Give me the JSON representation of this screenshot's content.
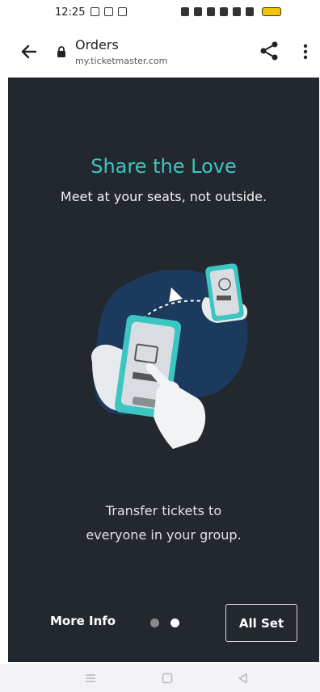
{
  "status_bar": {
    "time": "12:25"
  },
  "header": {
    "title": "Orders",
    "url": "my.ticketmaster.com"
  },
  "slide": {
    "headline": "Share the Love",
    "subhead": "Meet at your seats, not outside.",
    "body_lines": [
      "Transfer tickets to",
      "everyone in your group."
    ],
    "illustration_icon": "phone-transfer-illustration"
  },
  "footer": {
    "more_info_label": "More Info",
    "all_set_label": "All Set",
    "pagination": {
      "total": 2,
      "current": 2
    }
  },
  "colors": {
    "panel_bg": "#23272e",
    "accent": "#3cc6c1",
    "dot_active": "#ffffff",
    "dot_inactive": "#8a8a8a"
  },
  "icons": [
    "back-arrow-icon",
    "lock-icon",
    "share-icon",
    "more-vert-icon",
    "recent-apps-icon",
    "home-icon",
    "back-nav-icon"
  ]
}
